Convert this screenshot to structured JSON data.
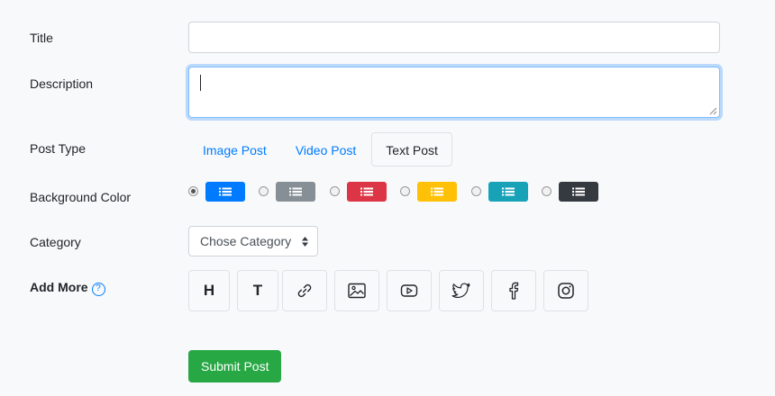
{
  "form": {
    "title_label": "Title",
    "title_value": "",
    "description_label": "Description",
    "description_value": "",
    "post_type_label": "Post Type",
    "post_types": [
      {
        "label": "Image Post",
        "active": false
      },
      {
        "label": "Video Post",
        "active": false
      },
      {
        "label": "Text Post",
        "active": true
      }
    ],
    "background_color_label": "Background Color",
    "background_colors": [
      {
        "color": "#007bff",
        "checked": true
      },
      {
        "color": "#868e96",
        "checked": false
      },
      {
        "color": "#dc3545",
        "checked": false
      },
      {
        "color": "#ffc107",
        "checked": false
      },
      {
        "color": "#17a2b8",
        "checked": false
      },
      {
        "color": "#343a40",
        "checked": false
      }
    ],
    "category_label": "Category",
    "category_selected": "Chose Category",
    "add_more_label": "Add More",
    "add_more_help_icon": "question-circle-icon",
    "add_more_tools": [
      {
        "label": "H",
        "icon": "heading"
      },
      {
        "label": "T",
        "icon": "text"
      },
      {
        "label": "",
        "icon": "link-icon"
      },
      {
        "label": "",
        "icon": "image-icon"
      },
      {
        "label": "",
        "icon": "youtube-icon"
      },
      {
        "label": "",
        "icon": "twitter-icon"
      },
      {
        "label": "",
        "icon": "facebook-icon"
      },
      {
        "label": "",
        "icon": "instagram-icon"
      }
    ],
    "submit_label": "Submit Post"
  }
}
